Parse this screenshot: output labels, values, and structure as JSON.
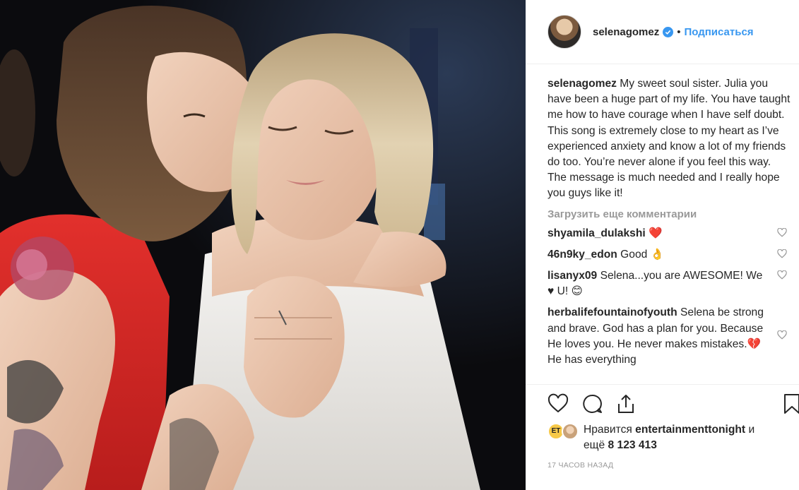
{
  "post": {
    "username": "selenagomez",
    "separator": "•",
    "follow_label": "Подписаться",
    "caption": {
      "username": "selenagomez",
      "text": "My sweet soul sister. Julia you have been a huge part of my life. You have taught me how to have courage when I have self doubt. This song is extremely close to my heart as I’ve experienced anxiety and know a lot of my friends do too. You’re never alone if you feel this way. The message is much needed and I really hope you guys like it!"
    },
    "load_more_label": "Загрузить еще комментарии",
    "comments": [
      {
        "username": "shyamila_dulakshi",
        "text": "❤️"
      },
      {
        "username": "46n9ky_edon",
        "text": "Good 👌"
      },
      {
        "username": "lisanyx09",
        "text": "Selena...you are AWESOME! We ♥ U! 😊"
      },
      {
        "username": "herbalifefountainofyouth",
        "text": "Selena be strong and brave. God has a plan for you. Because He loves you. He never makes mistakes.💔 He has everything"
      }
    ],
    "likes": {
      "prefix": "Нравится",
      "liker": "entertainmenttonight",
      "conjunction": "и",
      "more_prefix": "ещё",
      "count": "8 123 413",
      "liker_avatar_label": "ET"
    },
    "timestamp": "17 ЧАСОВ НАЗАД"
  },
  "icons": {
    "like": "heart-outline-icon",
    "comment": "speech-bubble-icon",
    "share": "share-icon",
    "save": "bookmark-icon",
    "verified": "verified-badge-icon"
  },
  "colors": {
    "link_blue": "#3897f0",
    "muted_gray": "#999999",
    "text": "#262626",
    "divider": "#efefef"
  }
}
